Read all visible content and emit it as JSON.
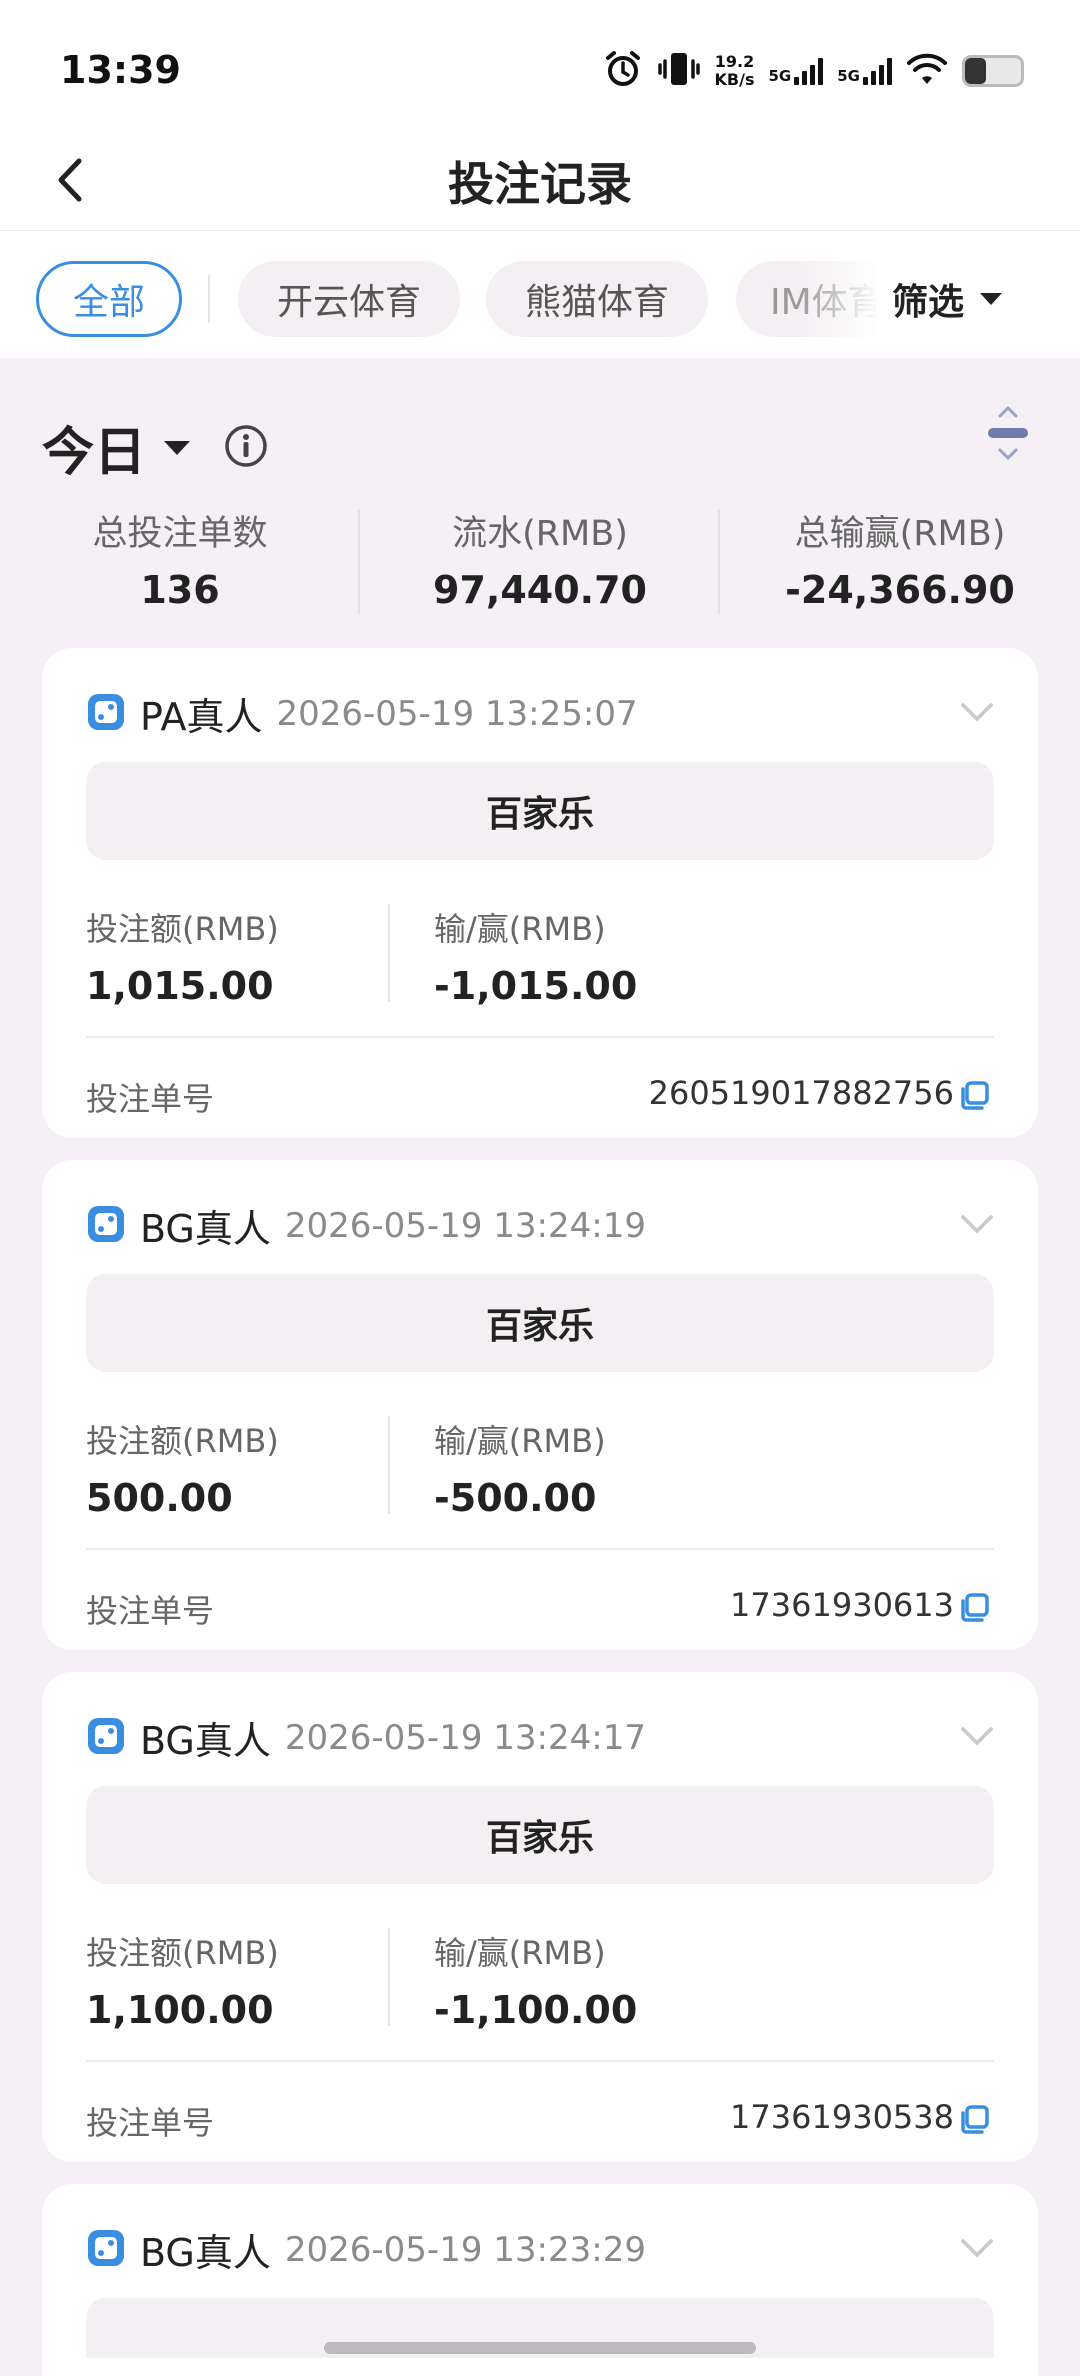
{
  "status_bar": {
    "time": "13:39",
    "net_speed_value": "19.2",
    "net_speed_unit": "KB/s",
    "sim1": "5G",
    "sim2": "5G",
    "battery_level": 0.38
  },
  "header": {
    "title": "投注记录"
  },
  "tabs": [
    {
      "label": "全部",
      "active": true
    },
    {
      "label": "开云体育",
      "active": false
    },
    {
      "label": "熊猫体育",
      "active": false
    },
    {
      "label": "IM体育",
      "active": false
    }
  ],
  "filter": {
    "label": "筛选"
  },
  "period": {
    "label": "今日"
  },
  "summary": {
    "count_label": "总投注单数",
    "count_value": "136",
    "turnover_label": "流水(RMB)",
    "turnover_value": "97,440.70",
    "winloss_label": "总输赢(RMB)",
    "winloss_value": "-24,366.90"
  },
  "card_labels": {
    "bet_amount": "投注额(RMB)",
    "win_loss": "输/赢(RMB)",
    "bet_no": "投注单号"
  },
  "records": [
    {
      "platform": "PA真人",
      "datetime": "2026-05-19 13:25:07",
      "game": "百家乐",
      "bet_amount": "1,015.00",
      "win_loss": "-1,015.00",
      "bet_no": "260519017882756"
    },
    {
      "platform": "BG真人",
      "datetime": "2026-05-19 13:24:19",
      "game": "百家乐",
      "bet_amount": "500.00",
      "win_loss": "-500.00",
      "bet_no": "17361930613"
    },
    {
      "platform": "BG真人",
      "datetime": "2026-05-19 13:24:17",
      "game": "百家乐",
      "bet_amount": "1,100.00",
      "win_loss": "-1,100.00",
      "bet_no": "17361930538"
    },
    {
      "platform": "BG真人",
      "datetime": "2026-05-19 13:23:29",
      "game": "",
      "bet_amount": "",
      "win_loss": "",
      "bet_no": ""
    }
  ],
  "colors": {
    "accent": "#3a8ee0",
    "background": "#f4f0f5",
    "chip": "#f4eff3"
  }
}
